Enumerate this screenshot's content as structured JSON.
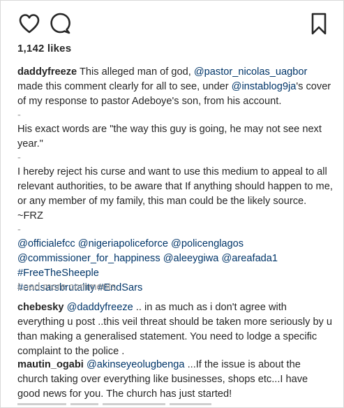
{
  "actions": {
    "like_icon": "heart-outline-icon",
    "comment_icon": "speech-bubble-icon",
    "save_icon": "bookmark-icon"
  },
  "likes": {
    "text": "1,142 likes"
  },
  "caption": {
    "username": "daddyfreeze",
    "p1_a": "This alleged man of god,",
    "p1_mention1": "@pastor_nicolas_uagbor",
    "p1_b": "made this comment clearly for all to see, under",
    "p1_mention2": "@instablog9ja",
    "p1_c": "'s cover of my response to pastor Adeboye's son, from his account.",
    "dash": "-",
    "p2": "His exact words are \"the way this guy is going, he may not see next year.\"",
    "p3": "I hereby reject his curse and want to use this medium to appeal to all relevant authorities, to be aware that If anything should happen to me, or any member of my family, this man could be the likely source. ~FRZ",
    "mentions": [
      "@officialefcc",
      "@nigeriapoliceforce",
      "@policenglagos",
      "@commissioner_for_happiness",
      "@aleeygiwa",
      "@areafada1"
    ],
    "hashtags": [
      "#FreeTheSheeple",
      "#endsarsbrutality",
      "#EndSars"
    ]
  },
  "load_more": "Load more comments",
  "comments": [
    {
      "username": "chebesky",
      "mention": "@daddyfreeze",
      "text": ".. in as much as i don't agree with everything u post ..this veil threat should be taken more seriously by u than making a generalised statement. You need to lodge a specific complaint to the police ."
    },
    {
      "username": "mautin_ogabi",
      "mention": "@akinseyeolugbenga",
      "text": "...If the issue is about the church taking over everything like businesses, shops etc...I have good news for you. The church has just started!"
    }
  ],
  "colors": {
    "text": "#262626",
    "link": "#003569",
    "muted": "#999999",
    "border": "#d9d9d9"
  }
}
